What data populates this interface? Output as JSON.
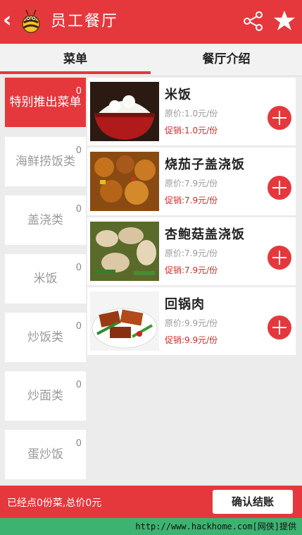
{
  "header": {
    "back_icon": "‹",
    "title": "员工餐厅"
  },
  "tabs": [
    {
      "label": "菜单"
    },
    {
      "label": "餐厅介绍"
    }
  ],
  "categories": [
    {
      "label": "特别推出菜单",
      "count": "0",
      "active": true
    },
    {
      "label": "海鲜捞饭类",
      "count": "0"
    },
    {
      "label": "盖浇类",
      "count": "0"
    },
    {
      "label": "米饭",
      "count": "0"
    },
    {
      "label": "炒饭类",
      "count": "0"
    },
    {
      "label": "炒面类",
      "count": "0"
    },
    {
      "label": "蛋炒饭",
      "count": "0"
    }
  ],
  "dishes": [
    {
      "name": "米饭",
      "original_price": "原价:1.0元/份",
      "promo_price": "促销:1.0元/份",
      "image": "rice-bowl"
    },
    {
      "name": "烧茄子盖浇饭",
      "original_price": "原价:7.9元/份",
      "promo_price": "促销:7.9元/份",
      "image": "eggplant-dish"
    },
    {
      "name": "杏鲍菇盖浇饭",
      "original_price": "原价:7.9元/份",
      "promo_price": "促销:7.9元/份",
      "image": "mushroom-dish"
    },
    {
      "name": "回锅肉",
      "original_price": "原价:9.9元/份",
      "promo_price": "促销:9.9元/份",
      "image": "twice-cooked-pork"
    }
  ],
  "footer": {
    "summary": "已经点0份菜,总价0元",
    "confirm_label": "确认结账"
  },
  "watermark": "http://www.hackhome.com[网侠]提供",
  "colors": {
    "accent": "#e5383d",
    "promo": "#d32a2a",
    "watermark_bg": "#3cb371"
  }
}
